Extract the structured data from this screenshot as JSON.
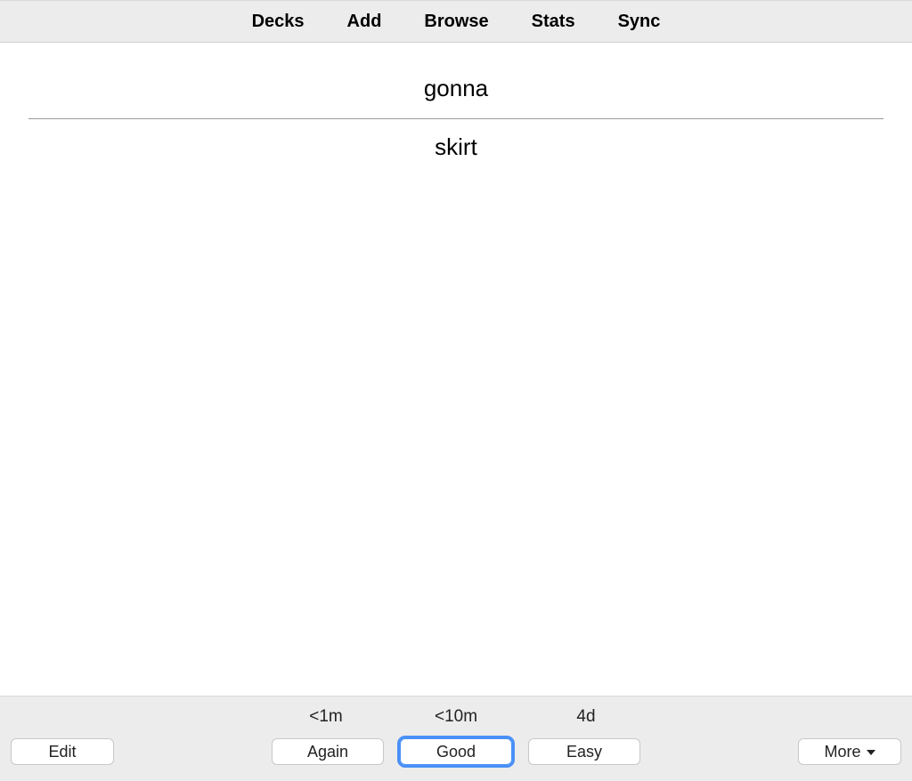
{
  "toolbar": {
    "items": [
      {
        "label": "Decks"
      },
      {
        "label": "Add"
      },
      {
        "label": "Browse"
      },
      {
        "label": "Stats"
      },
      {
        "label": "Sync"
      }
    ]
  },
  "card": {
    "front": "gonna",
    "back": "skirt"
  },
  "answer": {
    "intervals": {
      "again": "<1m",
      "good": "<10m",
      "easy": "4d"
    },
    "buttons": {
      "again": "Again",
      "good": "Good",
      "easy": "Easy"
    }
  },
  "bottom": {
    "edit": "Edit",
    "more": "More"
  }
}
